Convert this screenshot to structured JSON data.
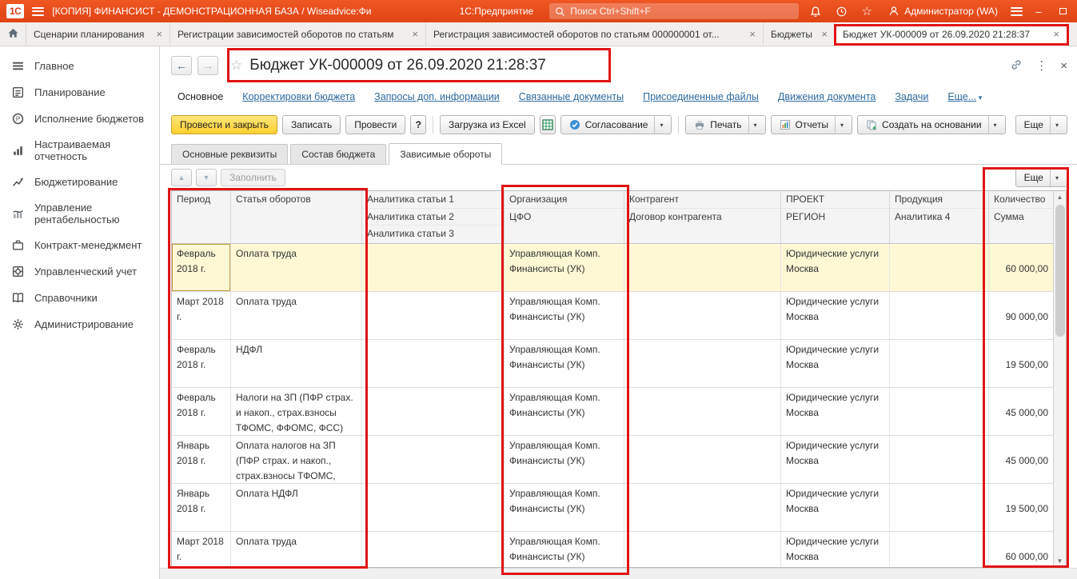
{
  "colors": {
    "topbar": "#e8491c",
    "primary_button": "#ffd02e",
    "selected_row": "#fff8d5",
    "selected_cell": "#ffe48a",
    "annotation": "#e11414",
    "link": "#2d6a9f"
  },
  "topbar": {
    "logo": "1С",
    "window_title": "[КОПИЯ] ФИНАНСИСТ - ДЕМОНСТРАЦИОННАЯ БАЗА / Wiseadvice:Финансист, ...",
    "app_name": "1С:Предприятие",
    "search_placeholder": "Поиск Ctrl+Shift+F",
    "user": "Администратор (WA)"
  },
  "tabbar": {
    "tabs": [
      {
        "label": "Сценарии планирования"
      },
      {
        "label": "Регистрации зависимостей оборотов по статьям"
      },
      {
        "label": "Регистрация зависимостей оборотов по статьям 000000001 от..."
      },
      {
        "label": "Бюджеты"
      },
      {
        "label": "Бюджет УК-000009 от 26.09.2020 21:28:37",
        "active": true
      }
    ]
  },
  "sidebar": {
    "items": [
      {
        "label": "Главное",
        "icon": "menu"
      },
      {
        "label": "Планирование",
        "icon": "planning"
      },
      {
        "label": "Исполнение бюджетов",
        "icon": "budget-execution"
      },
      {
        "label": "Настраиваемая отчетность",
        "icon": "custom-reports"
      },
      {
        "label": "Бюджетирование",
        "icon": "budgeting"
      },
      {
        "label": "Управление рентабельностью",
        "icon": "profitability"
      },
      {
        "label": "Контракт-менеджмент",
        "icon": "contract"
      },
      {
        "label": "Управленческий учет",
        "icon": "management-accounting"
      },
      {
        "label": "Справочники",
        "icon": "reference"
      },
      {
        "label": "Администрирование",
        "icon": "gear"
      }
    ]
  },
  "document": {
    "title": "Бюджет УК-000009 от 26.09.2020 21:28:37",
    "nav_links": [
      {
        "label": "Основное",
        "active": true
      },
      {
        "label": "Корректировки бюджета"
      },
      {
        "label": "Запросы доп. информации"
      },
      {
        "label": "Связанные документы"
      },
      {
        "label": "Присоединенные файлы"
      },
      {
        "label": "Движения документа"
      },
      {
        "label": "Задачи"
      },
      {
        "label": "Еще...",
        "caret": true
      }
    ],
    "toolbar": {
      "post_and_close": "Провести и закрыть",
      "save": "Записать",
      "post": "Провести",
      "help": "?",
      "excel_load": "Загрузка из Excel",
      "approval": "Согласование",
      "print": "Печать",
      "reports": "Отчеты",
      "create_based_on": "Создать на основании",
      "more": "Еще"
    },
    "subtabs": [
      {
        "label": "Основные реквизиты"
      },
      {
        "label": "Состав бюджета"
      },
      {
        "label": "Зависимые обороты",
        "active": true
      }
    ],
    "grid_toolbar": {
      "fill": "Заполнить",
      "more": "Еще"
    }
  },
  "table": {
    "header": {
      "period": "Период",
      "item": "Статья оборотов",
      "analytics1": "Аналитика статьи 1",
      "analytics2": "Аналитика статьи 2",
      "analytics3": "Аналитика статьи 3",
      "org": "Организация",
      "cfo": "ЦФО",
      "contragent": "Контрагент",
      "contract": "Договор контрагента",
      "project": "ПРОЕКТ",
      "region": "РЕГИОН",
      "production": "Продукция",
      "analytics4": "Аналитика 4",
      "quantity": "Количество",
      "sum": "Сумма"
    },
    "rows": [
      {
        "period": "Февраль 2018 г.",
        "item": "Оплата труда",
        "org": "Управляющая Комп.",
        "cfo": "Финансисты (УК)",
        "project": "Юридические услуги",
        "region": "Москва",
        "sum": "60 000,00",
        "selected": true
      },
      {
        "period": "Март 2018 г.",
        "item": "Оплата труда",
        "org": "Управляющая Комп.",
        "cfo": "Финансисты (УК)",
        "project": "Юридические услуги",
        "region": "Москва",
        "sum": "90 000,00"
      },
      {
        "period": "Февраль 2018 г.",
        "item": "НДФЛ",
        "org": "Управляющая Комп.",
        "cfo": "Финансисты (УК)",
        "project": "Юридические услуги",
        "region": "Москва",
        "sum": "19 500,00"
      },
      {
        "period": "Февраль 2018 г.",
        "item": "Налоги на ЗП (ПФР страх. и накоп., страх.взносы ТФОМС, ФФОМС, ФСС)",
        "org": "Управляющая Комп.",
        "cfo": "Финансисты (УК)",
        "project": "Юридические услуги",
        "region": "Москва",
        "sum": "45 000,00"
      },
      {
        "period": "Январь 2018 г.",
        "item": "Оплата налогов на ЗП (ПФР страх. и накоп., страх.взносы ТФОМС, ФФОМС, ФСС)",
        "org": "Управляющая Комп.",
        "cfo": "Финансисты (УК)",
        "project": "Юридические услуги",
        "region": "Москва",
        "sum": "45 000,00"
      },
      {
        "period": "Январь 2018 г.",
        "item": "Оплата НДФЛ",
        "org": "Управляющая Комп.",
        "cfo": "Финансисты (УК)",
        "project": "Юридические услуги",
        "region": "Москва",
        "sum": "19 500,00"
      },
      {
        "period": "Март 2018 г.",
        "item": "Оплата труда",
        "org": "Управляющая Комп.",
        "cfo": "Финансисты (УК)",
        "project": "Юридические услуги",
        "region": "Москва",
        "sum": "60 000,00"
      }
    ]
  }
}
